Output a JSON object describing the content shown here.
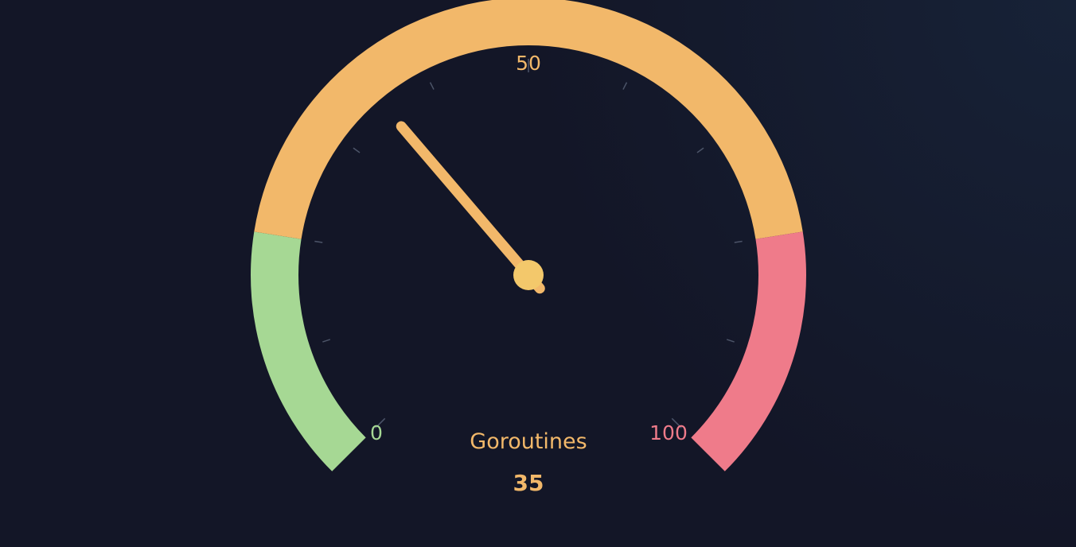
{
  "chart_data": {
    "type": "gauge",
    "title": "Goroutines",
    "value": 35,
    "value_text": "35",
    "min": 0,
    "max": 100,
    "min_label": "0",
    "mid_label": "50",
    "max_label": "100",
    "bands": [
      {
        "from": 0,
        "to": 20,
        "color": "#a6d894"
      },
      {
        "from": 20,
        "to": 80,
        "color": "#f2b86a"
      },
      {
        "from": 80,
        "to": 100,
        "color": "#ef7b8a"
      }
    ],
    "needle_color": "#f2b86a",
    "hub_color": "#f3c86b",
    "title_color": "#f2b86a",
    "value_color": "#f2b86a",
    "tick_color": "#4c5468"
  }
}
